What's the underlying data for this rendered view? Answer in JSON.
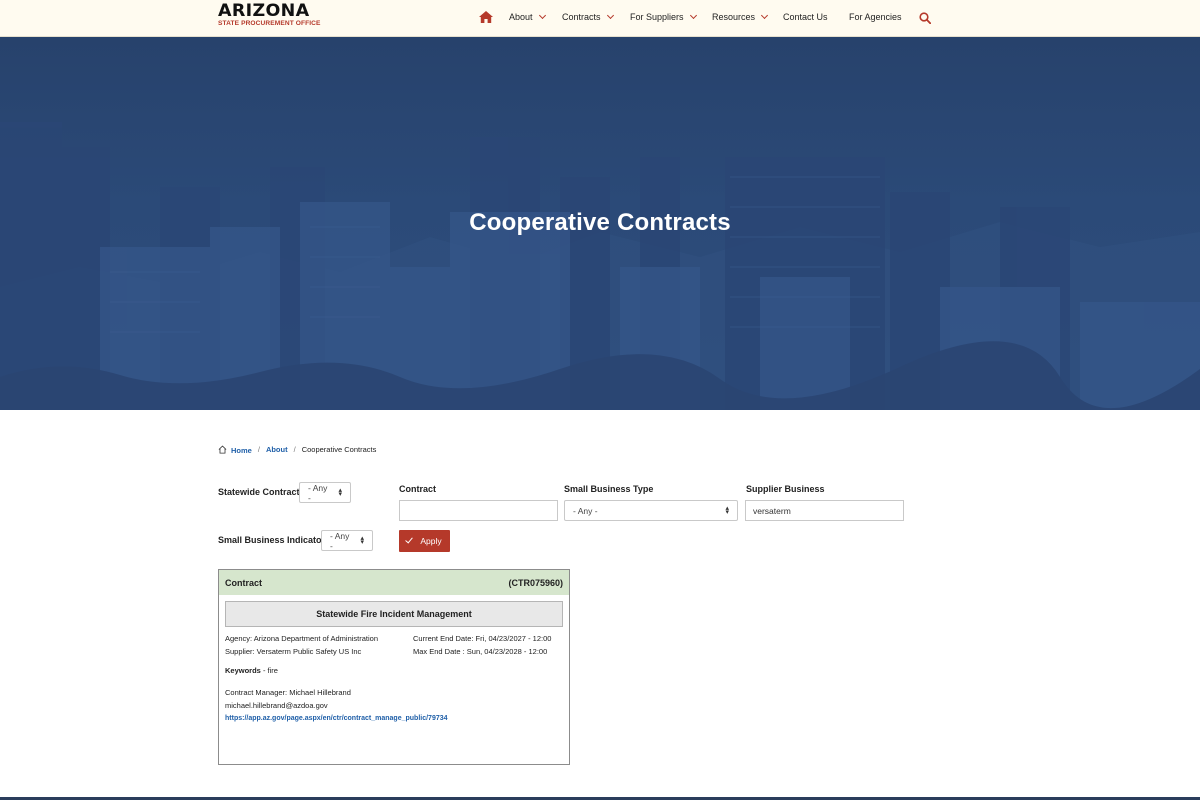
{
  "header": {
    "logo": {
      "title": "ARIZONA",
      "subtitle": "STATE PROCUREMENT OFFICE"
    },
    "nav": [
      {
        "label": "About",
        "dropdown": true
      },
      {
        "label": "Contracts",
        "dropdown": true
      },
      {
        "label": "For Suppliers",
        "dropdown": true
      },
      {
        "label": "Resources",
        "dropdown": true
      },
      {
        "label": "Contact Us",
        "dropdown": false
      },
      {
        "label": "For Agencies",
        "dropdown": false
      }
    ],
    "icons": {
      "home": "home-icon",
      "search": "search-icon",
      "accent": "#b5392a"
    }
  },
  "hero": {
    "title": "Cooperative Contracts",
    "overlay_color": "#2b4a78"
  },
  "breadcrumb": {
    "home": "Home",
    "about": "About",
    "current": "Cooperative Contracts"
  },
  "filters": {
    "statewide_contract": {
      "label": "Statewide Contract",
      "value": "- Any -"
    },
    "contract": {
      "label": "Contract",
      "value": ""
    },
    "small_business_type": {
      "label": "Small Business Type",
      "value": "- Any -"
    },
    "supplier_business": {
      "label": "Supplier Business",
      "value": "versaterm"
    },
    "small_business_indicator": {
      "label": "Small Business Indicator",
      "value": "- Any -"
    },
    "apply_label": "Apply"
  },
  "result": {
    "header_label": "Contract",
    "contract_id": "(CTR075960)",
    "title": "Statewide Fire Incident Management",
    "agency": "Agency: Arizona Department of Administration",
    "supplier": "Supplier: Versaterm Public Safety US Inc",
    "current_end": "Current End Date: Fri, 04/23/2027 - 12:00",
    "max_end": "Max End Date : Sun, 04/23/2028 - 12:00",
    "keywords_label": "Keywords",
    "keywords_value": " - fire",
    "manager": "Contract Manager: Michael Hillebrand",
    "email": "michael.hillebrand@azdoa.gov",
    "link": "https://app.az.gov/page.aspx/en/ctr/contract_manage_public/79734",
    "header_color": "#d6e6cd"
  }
}
